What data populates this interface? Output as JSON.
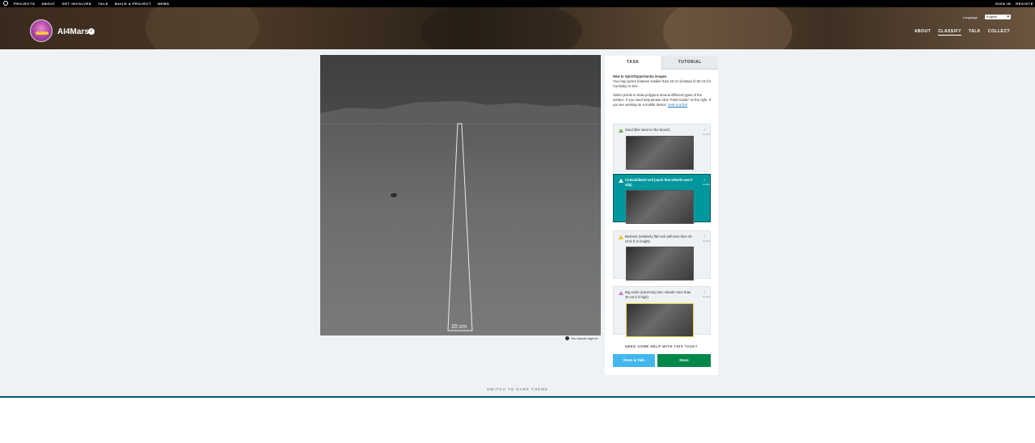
{
  "topbar": {
    "nav": [
      "PROJECTS",
      "ABOUT",
      "GET INVOLVED",
      "TALK",
      "BUILD A PROJECT",
      "NEWS"
    ],
    "sign_in": "SIGN IN",
    "register": "REGISTE"
  },
  "project": {
    "name": "AI4Mars",
    "language_label": "Language",
    "language_value": "English",
    "nav": [
      "ABOUT",
      "CLASSIFY",
      "TALK",
      "COLLECT"
    ],
    "active_nav": "CLASSIFY"
  },
  "viewer": {
    "scale_label": "20 cm",
    "signin_note": "You should sign in!"
  },
  "panel": {
    "tabs": [
      "TASK",
      "TUTORIAL"
    ],
    "intro_heading": "New to Spirit/Opportunity images",
    "intro_line": "You may ignore features smaller than 20 cm (instead of 50 cm for Curiosity) in size.",
    "instructions": "Select points to draw polygons around different types of the surface. If you need help please click \"Field Guide\" on the right. If you are working on a mobile device,",
    "instructions_link": "here is a hint",
    "answers": [
      {
        "label": "Sand (like sand on the beach)",
        "help": "?",
        "help_sub": "Details",
        "selected": false,
        "color": "#6ab04c"
      },
      {
        "label": "Consolidated soil (such that wheels won't slip)",
        "help": "?",
        "help_sub": "Details",
        "selected": true,
        "color": "#00979d"
      },
      {
        "label": "Bedrock (relatively flat rock with less than 30 cm/1 ft in height)",
        "help": "?",
        "help_sub": "Details",
        "selected": false,
        "color": "#f1c40f"
      },
      {
        "label": "Big rocks (extremely rare; stands more than 30 cm/1 ft high)",
        "help": "?",
        "help_sub": "Details",
        "selected": false,
        "color": "#c77dcf"
      }
    ],
    "need_help": "NEED SOME HELP WITH THIS TASK?",
    "done_talk": "Done & Talk",
    "done": "Done"
  },
  "footer": {
    "switch_theme": "SWITCH TO DARK THEME"
  }
}
